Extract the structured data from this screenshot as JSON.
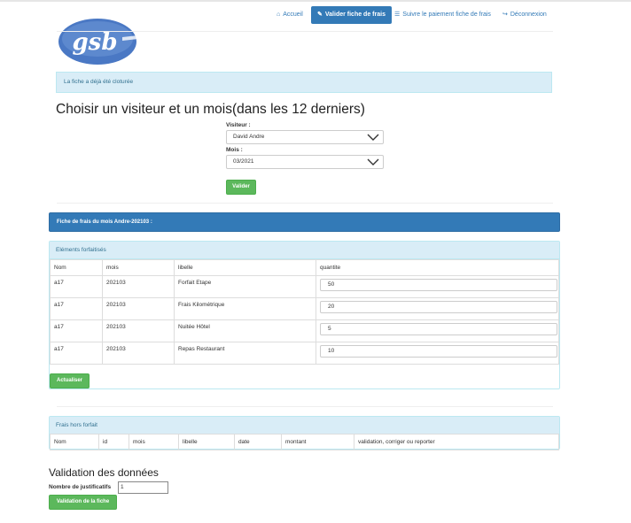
{
  "brand": {
    "logo_text": "gsb"
  },
  "nav": {
    "items": [
      {
        "label": "Accueil",
        "icon": "home-icon"
      },
      {
        "label": "Valider fiche de frais",
        "icon": "pencil-icon",
        "active": true
      },
      {
        "label": "Suivre le paiement fiche de frais",
        "icon": "list-icon"
      },
      {
        "label": "Déconnexion",
        "icon": "logout-icon"
      }
    ]
  },
  "alert": {
    "text": "La fiche a déjà été cloturée"
  },
  "selection": {
    "title": "Choisir un visiteur et un mois(dans les 12 derniers)",
    "visitor_label": "Visiteur :",
    "visitor_value": "David Andre",
    "month_label": "Mois :",
    "month_value": "03/2021",
    "submit_label": "Valider"
  },
  "fiche": {
    "title": "Fiche de frais du mois Andre-202103 :"
  },
  "forfait": {
    "title": "Eléments forfaitisés",
    "columns": [
      "Nom",
      "mois",
      "libelle",
      "quantite"
    ],
    "rows": [
      {
        "nom": "a17",
        "mois": "202103",
        "libelle": "Forfait Etape",
        "quantite": "50"
      },
      {
        "nom": "a17",
        "mois": "202103",
        "libelle": "Frais Kilométrique",
        "quantite": "20"
      },
      {
        "nom": "a17",
        "mois": "202103",
        "libelle": "Nuitée Hôtel",
        "quantite": "5"
      },
      {
        "nom": "a17",
        "mois": "202103",
        "libelle": "Repas Restaurant",
        "quantite": "10"
      }
    ],
    "update_label": "Actualiser"
  },
  "hors_forfait": {
    "title": "Frais hors forfait",
    "columns": [
      "Nom",
      "id",
      "mois",
      "libelle",
      "date",
      "montant",
      "validation, corriger ou reporter"
    ]
  },
  "validation": {
    "title": "Validation des données",
    "justificatifs_label": "Nombre de justificatifs",
    "justificatifs_value": "1",
    "submit_label": "Validation de la fiche"
  },
  "colors": {
    "primary": "#337ab7",
    "success": "#5cb85c",
    "info_bg": "#d9edf7",
    "info_text": "#31708f"
  }
}
